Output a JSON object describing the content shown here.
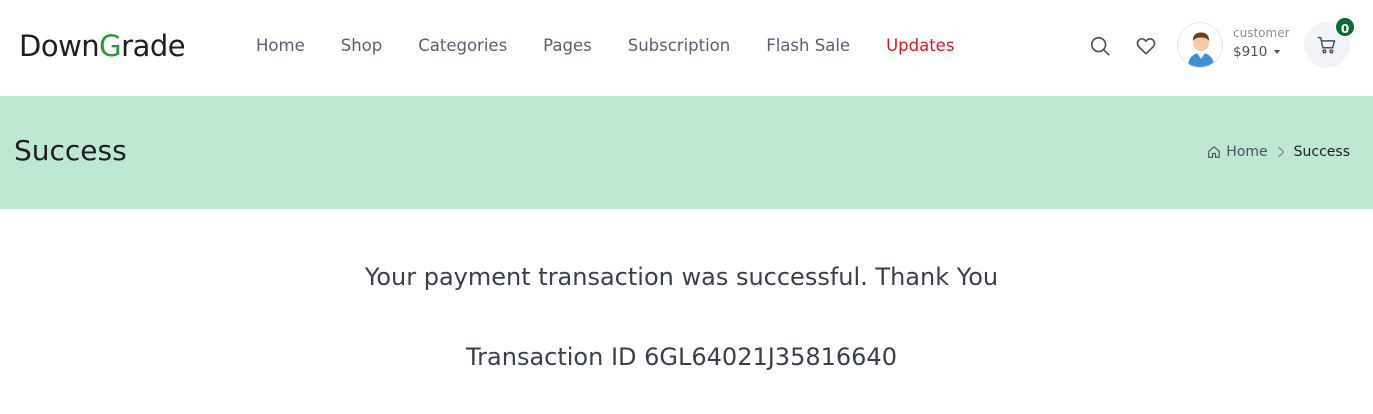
{
  "header": {
    "logo": {
      "part1": "Down",
      "part2": "G",
      "part3": "rade"
    },
    "nav": [
      {
        "label": "Home"
      },
      {
        "label": "Shop"
      },
      {
        "label": "Categories"
      },
      {
        "label": "Pages"
      },
      {
        "label": "Subscription"
      },
      {
        "label": "Flash Sale"
      },
      {
        "label": "Updates"
      }
    ],
    "account": {
      "label": "customer",
      "balance": "$910"
    },
    "cart": {
      "count": "0"
    },
    "icons": {
      "search": "search-icon",
      "wishlist": "heart-icon",
      "cart": "cart-icon",
      "avatar": "user-avatar"
    }
  },
  "banner": {
    "title": "Success",
    "breadcrumb": {
      "home": "Home",
      "current": "Success"
    }
  },
  "content": {
    "message": "Your payment transaction was successful. Thank You",
    "transaction": "Transaction ID 6GL64021J35816640"
  },
  "colors": {
    "banner_bg": "#bfe8d3",
    "accent_green": "#1f9a3c",
    "active_nav": "#e3141b",
    "badge_bg": "#0d6b2c"
  }
}
